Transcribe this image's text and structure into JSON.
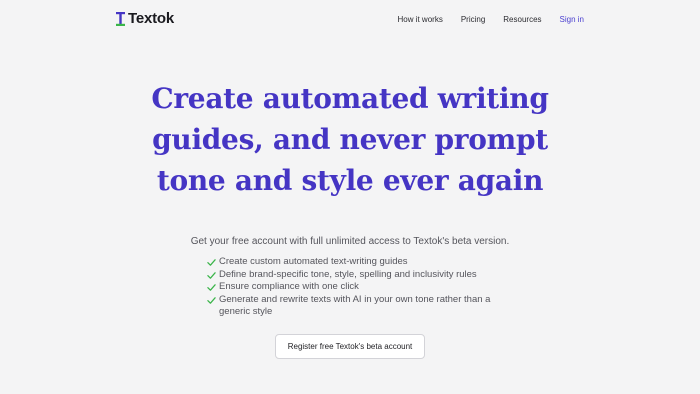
{
  "brand": {
    "name": "Textok",
    "accent_color": "#4535c4",
    "logo_icon": "text-cursor-logo-icon"
  },
  "nav": {
    "items": [
      {
        "label": "How it works"
      },
      {
        "label": "Pricing"
      },
      {
        "label": "Resources"
      }
    ],
    "signin_label": "Sign in"
  },
  "hero": {
    "title_lines": [
      "Create automated writing",
      "guides, and never prompt",
      "tone and style ever again"
    ],
    "subtitle": "Get your free account with full unlimited access to Textok's beta version."
  },
  "features": {
    "check_icon": "check-icon",
    "check_color": "#3bb54a",
    "items": [
      {
        "text": "Create custom automated text-writing guides"
      },
      {
        "text": "Define brand-specific tone, style, spelling and inclusivity rules"
      },
      {
        "text": "Ensure compliance with one click"
      },
      {
        "text": "Generate and rewrite texts with AI in your own tone rather than a generic style"
      }
    ]
  },
  "cta": {
    "label": "Register free Textok's beta account"
  }
}
